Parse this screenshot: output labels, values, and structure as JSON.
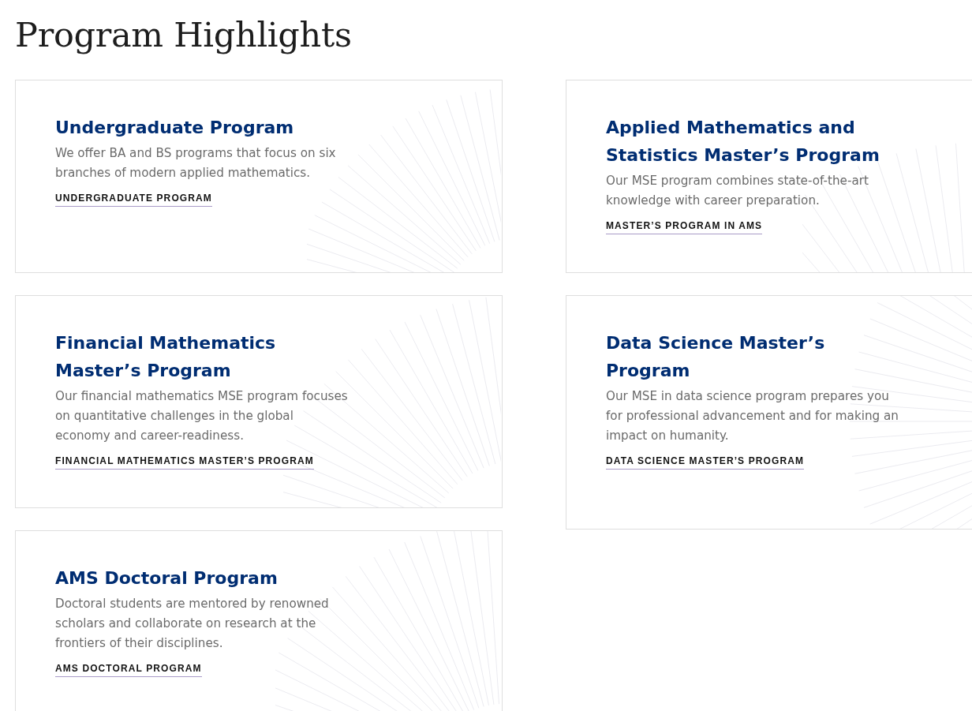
{
  "heading": "Program Highlights",
  "cards": [
    {
      "title": "Undergraduate Program",
      "description": "We offer BA and BS programs that focus on six branches of modern applied mathematics.",
      "link": "UNDERGRADUATE PROGRAM"
    },
    {
      "title": "Applied Mathematics and Statistics Master’s Program",
      "description": "Our MSE program combines state-of-the-art knowledge with career preparation.",
      "link": "MASTER’S PROGRAM IN AMS"
    },
    {
      "title": "Financial Mathematics Master’s Program",
      "description": "Our financial mathematics MSE program focuses on quantitative challenges in the global economy and career-readiness.",
      "link": "FINANCIAL MATHEMATICS MASTER’S PROGRAM"
    },
    {
      "title": "Data Science Master’s Program",
      "description": "Our MSE in data science program prepares you for professional advancement and for making an impact on humanity.",
      "link": "DATA SCIENCE MASTER’S PROGRAM"
    },
    {
      "title": "AMS Doctoral Program",
      "description": "Doctoral students are mentored by renowned scholars and collaborate on research at the frontiers of their disciplines.",
      "link": "AMS DOCTORAL PROGRAM"
    }
  ]
}
